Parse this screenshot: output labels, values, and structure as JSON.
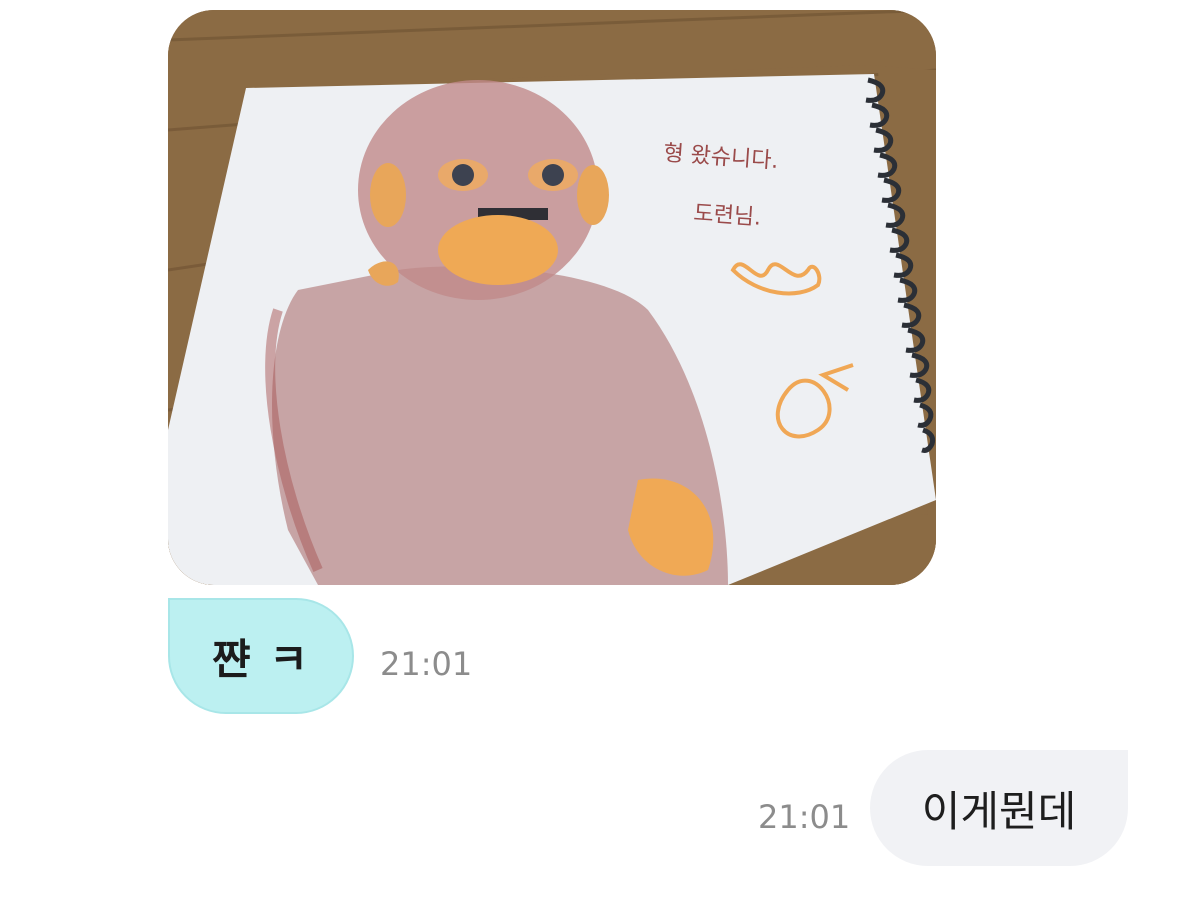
{
  "messages": {
    "incoming_image": {
      "alt": "",
      "drawing_text_line1": "형 왔슈니다.",
      "drawing_text_line2": "도련님."
    },
    "incoming_text": {
      "text": "쨘 ㅋ",
      "time": "21:01"
    },
    "outgoing_text": {
      "text": "이게뭔데",
      "time": "21:01"
    }
  },
  "colors": {
    "incoming_bubble": "#bcf0f1",
    "outgoing_bubble": "#f1f2f5",
    "timestamp": "#8c8c8c"
  }
}
